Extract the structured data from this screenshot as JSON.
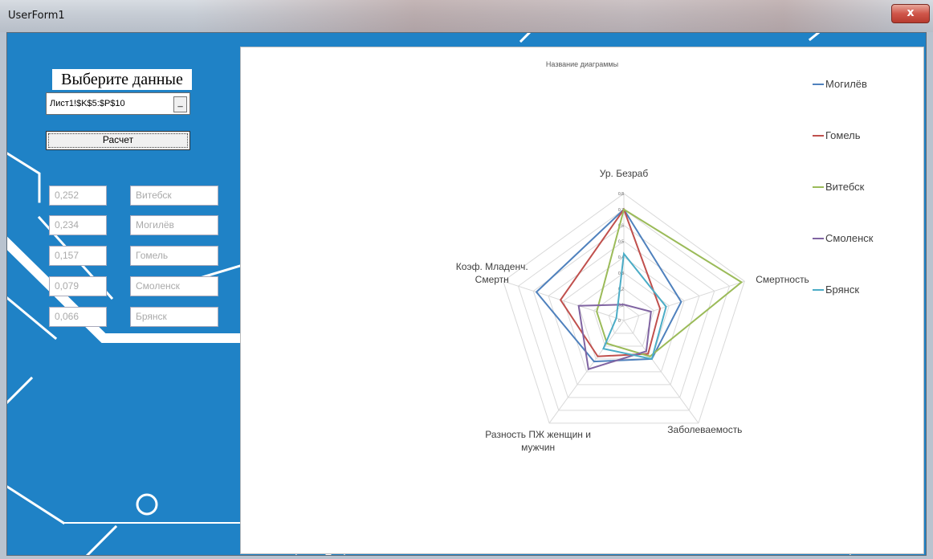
{
  "window": {
    "title": "UserForm1",
    "close_label": "x"
  },
  "form": {
    "heading": "Выберите данные",
    "range_value": "Лист1!$K$5:$P$10",
    "range_button": "_",
    "calc_button": "Расчет",
    "results": [
      {
        "value": "0,252",
        "city": "Витебск"
      },
      {
        "value": "0,234",
        "city": "Могилёв"
      },
      {
        "value": "0,157",
        "city": "Гомель"
      },
      {
        "value": "0,079",
        "city": "Смоленск"
      },
      {
        "value": "0,066",
        "city": "Брянск"
      }
    ]
  },
  "chart_data": {
    "type": "radar",
    "title": "Название диаграммы",
    "categories": [
      "Ур. Безраб",
      "Смертность",
      "Заболеваемость",
      "Разность ПЖ женщин и мужчин",
      "Коэф. Младенч. Смертн"
    ],
    "category_lines": [
      [
        "Ур. Безраб"
      ],
      [
        "Смертность"
      ],
      [
        "Заболеваемость"
      ],
      [
        "Разность ПЖ женщин и",
        "мужчин"
      ],
      [
        "Коэф. Младенч.",
        "Смертн"
      ]
    ],
    "ticks": [
      "0",
      "0,1",
      "0,2",
      "0,3",
      "0,4",
      "0,5",
      "0,6",
      "0,7",
      "0,8"
    ],
    "rmax": 0.8,
    "legend_position": "right",
    "series": [
      {
        "name": "Могилёв",
        "color": "#4f81bd",
        "values": [
          0.7,
          0.38,
          0.3,
          0.32,
          0.58
        ]
      },
      {
        "name": "Гомель",
        "color": "#c0504d",
        "values": [
          0.7,
          0.24,
          0.26,
          0.28,
          0.42
        ]
      },
      {
        "name": "Витебск",
        "color": "#9bbb59",
        "values": [
          0.7,
          0.78,
          0.28,
          0.18,
          0.18
        ]
      },
      {
        "name": "Смоленск",
        "color": "#8064a2",
        "values": [
          0.1,
          0.18,
          0.24,
          0.38,
          0.3
        ]
      },
      {
        "name": "Брянск",
        "color": "#4bacc6",
        "values": [
          0.42,
          0.28,
          0.3,
          0.22,
          0.05
        ]
      }
    ]
  }
}
